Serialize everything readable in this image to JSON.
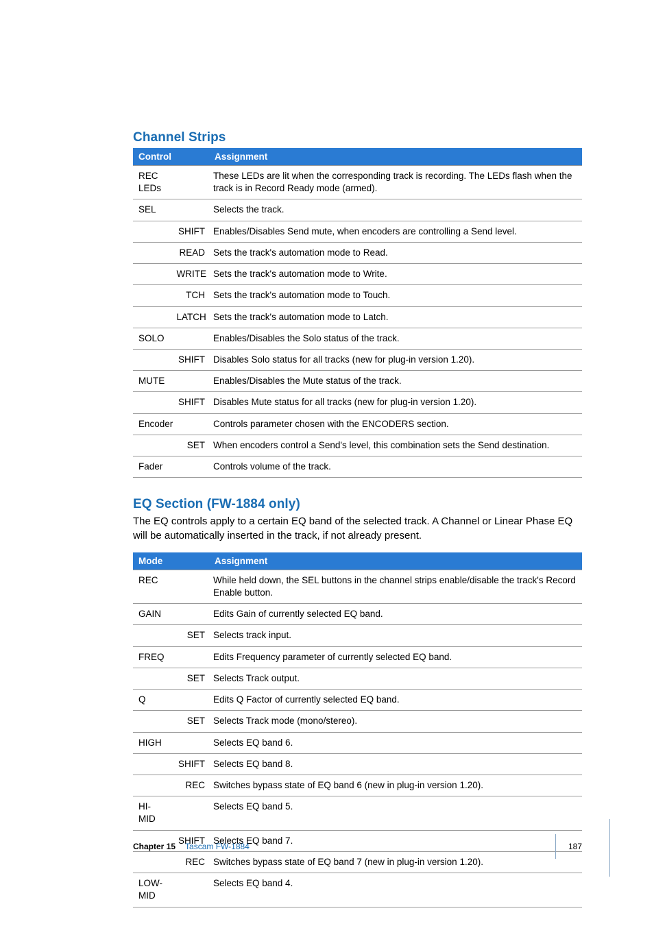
{
  "sections": {
    "channel_strips": {
      "heading": "Channel Strips",
      "table_headers": {
        "col1": "Control",
        "col3": "Assignment"
      },
      "rows": [
        {
          "c1": "REC LEDs",
          "c2": "",
          "c3": "These LEDs are lit when the corresponding track is recording. The LEDs flash when the track is in Record Ready mode (armed)."
        },
        {
          "c1": "SEL",
          "c2": "",
          "c3": "Selects the track."
        },
        {
          "c1": "",
          "c2": "SHIFT",
          "c3": "Enables/Disables Send mute, when encoders are controlling a Send level."
        },
        {
          "c1": "",
          "c2": "READ",
          "c3": "Sets the track's automation mode to Read."
        },
        {
          "c1": "",
          "c2": "WRITE",
          "c3": "Sets the track's automation mode to Write."
        },
        {
          "c1": "",
          "c2": "TCH",
          "c3": "Sets the track's automation mode to Touch."
        },
        {
          "c1": "",
          "c2": "LATCH",
          "c3": "Sets the track's automation mode to Latch."
        },
        {
          "c1": "SOLO",
          "c2": "",
          "c3": "Enables/Disables the Solo status of the track."
        },
        {
          "c1": "",
          "c2": "SHIFT",
          "c3": "Disables Solo status for all tracks (new for plug-in version 1.20)."
        },
        {
          "c1": "MUTE",
          "c2": "",
          "c3": "Enables/Disables the Mute status of the track."
        },
        {
          "c1": "",
          "c2": "SHIFT",
          "c3": "Disables Mute status for all tracks (new for plug-in version 1.20)."
        },
        {
          "c1": "Encoder",
          "c2": "",
          "c3": "Controls parameter chosen with the ENCODERS section."
        },
        {
          "c1": "",
          "c2": "SET",
          "c3": "When encoders control a Send's level, this combination sets the Send destination."
        },
        {
          "c1": "Fader",
          "c2": "",
          "c3": "Controls volume of the track."
        }
      ]
    },
    "eq_section": {
      "heading": "EQ Section (FW-1884 only)",
      "intro": "The EQ controls apply to a certain EQ band of the selected track. A Channel or Linear Phase EQ will be automatically inserted in the track, if not already present.",
      "table_headers": {
        "col1": "Mode",
        "col3": "Assignment"
      },
      "rows": [
        {
          "c1": "REC",
          "c2": "",
          "c3": "While held down, the SEL buttons in the channel strips enable/disable the track's Record Enable button."
        },
        {
          "c1": "GAIN",
          "c2": "",
          "c3": "Edits Gain of currently selected EQ band."
        },
        {
          "c1": "",
          "c2": "SET",
          "c3": "Selects track input."
        },
        {
          "c1": "FREQ",
          "c2": "",
          "c3": "Edits Frequency parameter of currently selected EQ band."
        },
        {
          "c1": "",
          "c2": "SET",
          "c3": "Selects Track output."
        },
        {
          "c1": "Q",
          "c2": "",
          "c3": "Edits Q Factor of currently selected EQ band."
        },
        {
          "c1": "",
          "c2": "SET",
          "c3": "Selects Track mode (mono/stereo)."
        },
        {
          "c1": "HIGH",
          "c2": "",
          "c3": "Selects EQ band 6."
        },
        {
          "c1": "",
          "c2": "SHIFT",
          "c3": "Selects EQ band 8."
        },
        {
          "c1": "",
          "c2": "REC",
          "c3": "Switches bypass state of EQ band 6 (new in plug-in version 1.20)."
        },
        {
          "c1": "HI-MID",
          "c2": "",
          "c3": "Selects EQ band 5."
        },
        {
          "c1": "",
          "c2": "SHIFT",
          "c3": "Selects EQ band 7."
        },
        {
          "c1": "",
          "c2": "REC",
          "c3": "Switches bypass state of EQ band 7 (new in plug-in version 1.20)."
        },
        {
          "c1": "LOW-MID",
          "c2": "",
          "c3": "Selects EQ band 4."
        }
      ]
    }
  },
  "footer": {
    "chapter_label": "Chapter 15",
    "chapter_title": "Tascam FW-1884",
    "page_number": "187"
  }
}
